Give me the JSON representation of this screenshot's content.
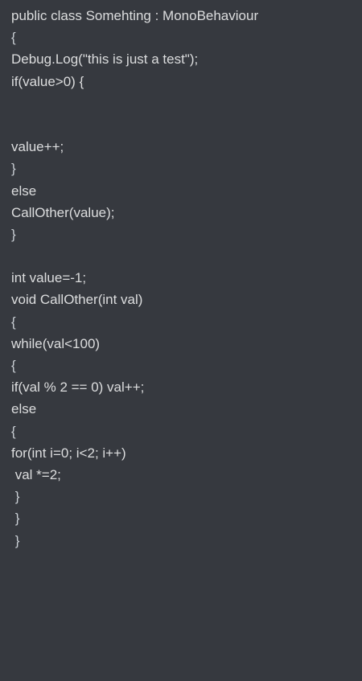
{
  "code": {
    "lines": [
      "public class Somehting : MonoBehaviour",
      "{",
      "Debug.Log(\"this is just a test\");",
      "if(value>0) {",
      "",
      "",
      "value++;",
      "}",
      "else",
      "CallOther(value);",
      "}",
      "",
      "int value=-1;",
      "void CallOther(int val)",
      "{",
      "while(val<100)",
      "{",
      "if(val % 2 == 0) val++;",
      "else",
      "{",
      "for(int i=0; i<2; i++)",
      " val *=2;",
      " }",
      " }",
      " }"
    ]
  }
}
